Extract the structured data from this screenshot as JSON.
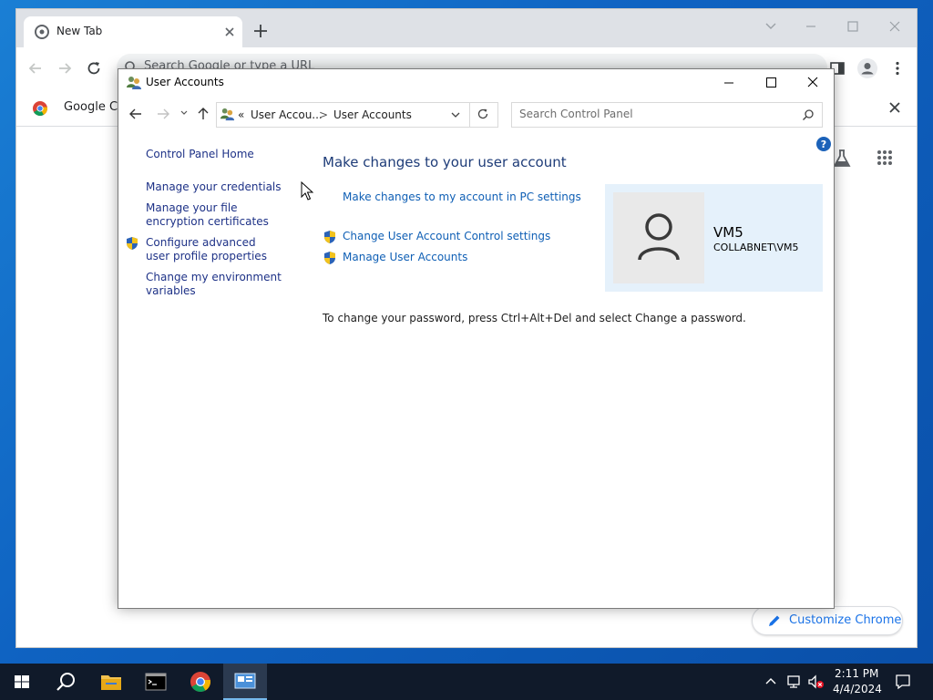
{
  "chrome": {
    "tab_title": "New Tab",
    "omnibox_placeholder": "Search Google or type a URL",
    "bookmark_label": "Google Ch",
    "customize_label": "Customize Chrome"
  },
  "control_panel": {
    "window_title": "User Accounts",
    "breadcrumb": {
      "overflow": "«",
      "parent": "User Accou...",
      "separator": ">",
      "current": "User Accounts"
    },
    "search_placeholder": "Search Control Panel",
    "left_nav": {
      "home": "Control Panel Home",
      "credentials": "Manage your credentials",
      "encryption": "Manage your file encryption certificates",
      "advanced_profile": "Configure advanced user profile properties",
      "environment": "Change my environment variables"
    },
    "heading": "Make changes to your user account",
    "links": {
      "pc_settings": "Make changes to my account in PC settings",
      "uac": "Change User Account Control settings",
      "manage": "Manage User Accounts"
    },
    "password_note": "To change your password, press Ctrl+Alt+Del and select Change a password.",
    "user": {
      "name": "VM5",
      "domain": "COLLABNET\\VM5"
    }
  },
  "taskbar": {
    "time": "2:11 PM",
    "date": "4/4/2024"
  },
  "colors": {
    "link": "#0f5fb5",
    "heading": "#1e3c78",
    "user_tile": "#e5f1fb",
    "taskbar": "#101a2a",
    "desktop": "#0f63c2"
  }
}
